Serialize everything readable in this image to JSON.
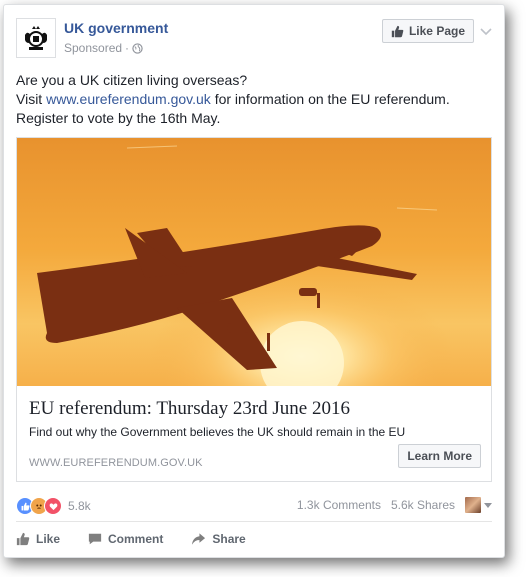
{
  "post": {
    "page_name": "UK government",
    "sponsored_label": "Sponsored",
    "like_page_label": "Like Page",
    "text_line1": "Are you a UK citizen living overseas?",
    "text_visit": "Visit",
    "text_link": "www.eureferendum.gov.uk",
    "text_after_link": "for information on the EU referendum.",
    "text_line3": "Register to vote by the 16th May."
  },
  "attachment": {
    "title": "EU referendum: Thursday 23rd June 2016",
    "description": "Find out why the Government believes the UK should remain in the EU",
    "domain": "WWW.EUREFERENDUM.GOV.UK",
    "cta_label": "Learn More"
  },
  "stats": {
    "reactions_count": "5.8k",
    "comments": "1.3k Comments",
    "shares": "5.6k Shares"
  },
  "actions": {
    "like": "Like",
    "comment": "Comment",
    "share": "Share"
  },
  "colors": {
    "link": "#365899",
    "like_blue": "#5890ff",
    "angry_orange": "#f0a44b",
    "love_red": "#f25268"
  }
}
